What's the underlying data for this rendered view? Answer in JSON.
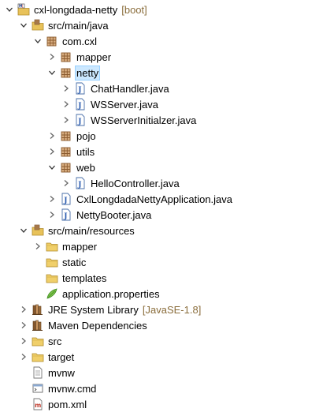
{
  "rows": [
    {
      "label": "cxl-longdada-netty",
      "decoration": "[boot]",
      "icon": "maven-project-icon",
      "expand": "expanded",
      "selected": false
    },
    {
      "label": "src/main/java",
      "decoration": "",
      "icon": "source-folder-icon",
      "expand": "expanded",
      "selected": false
    },
    {
      "label": "com.cxl",
      "decoration": "",
      "icon": "package-icon",
      "expand": "expanded",
      "selected": false
    },
    {
      "label": "mapper",
      "decoration": "",
      "icon": "package-icon",
      "expand": "collapsed",
      "selected": false
    },
    {
      "label": "netty",
      "decoration": "",
      "icon": "package-icon",
      "expand": "expanded",
      "selected": true
    },
    {
      "label": "ChatHandler.java",
      "decoration": "",
      "icon": "java-file-icon",
      "expand": "collapsed",
      "selected": false
    },
    {
      "label": "WSServer.java",
      "decoration": "",
      "icon": "java-file-icon",
      "expand": "collapsed",
      "selected": false
    },
    {
      "label": "WSServerInitialzer.java",
      "decoration": "",
      "icon": "java-file-icon",
      "expand": "collapsed",
      "selected": false
    },
    {
      "label": "pojo",
      "decoration": "",
      "icon": "package-icon",
      "expand": "collapsed",
      "selected": false
    },
    {
      "label": "utils",
      "decoration": "",
      "icon": "package-icon",
      "expand": "collapsed",
      "selected": false
    },
    {
      "label": "web",
      "decoration": "",
      "icon": "package-icon",
      "expand": "expanded",
      "selected": false
    },
    {
      "label": "HelloController.java",
      "decoration": "",
      "icon": "java-file-icon",
      "expand": "collapsed",
      "selected": false
    },
    {
      "label": "CxlLongdadaNettyApplication.java",
      "decoration": "",
      "icon": "java-file-icon",
      "expand": "collapsed",
      "selected": false
    },
    {
      "label": "NettyBooter.java",
      "decoration": "",
      "icon": "java-file-icon",
      "expand": "collapsed",
      "selected": false
    },
    {
      "label": "src/main/resources",
      "decoration": "",
      "icon": "source-folder-icon",
      "expand": "expanded",
      "selected": false
    },
    {
      "label": "mapper",
      "decoration": "",
      "icon": "folder-icon",
      "expand": "collapsed",
      "selected": false
    },
    {
      "label": "static",
      "decoration": "",
      "icon": "folder-icon",
      "expand": "none",
      "selected": false
    },
    {
      "label": "templates",
      "decoration": "",
      "icon": "folder-icon",
      "expand": "none",
      "selected": false
    },
    {
      "label": "application.properties",
      "decoration": "",
      "icon": "properties-file-icon",
      "expand": "none",
      "selected": false
    },
    {
      "label": "JRE System Library",
      "decoration": "[JavaSE-1.8]",
      "icon": "library-icon",
      "expand": "collapsed",
      "selected": false
    },
    {
      "label": "Maven Dependencies",
      "decoration": "",
      "icon": "library-icon",
      "expand": "collapsed",
      "selected": false
    },
    {
      "label": "src",
      "decoration": "",
      "icon": "folder-icon",
      "expand": "collapsed",
      "selected": false
    },
    {
      "label": "target",
      "decoration": "",
      "icon": "folder-icon",
      "expand": "collapsed",
      "selected": false
    },
    {
      "label": "mvnw",
      "decoration": "",
      "icon": "text-file-icon",
      "expand": "none",
      "selected": false
    },
    {
      "label": "mvnw.cmd",
      "decoration": "",
      "icon": "cmd-file-icon",
      "expand": "none",
      "selected": false
    },
    {
      "label": "pom.xml",
      "decoration": "",
      "icon": "maven-pom-icon",
      "expand": "none",
      "selected": false
    }
  ],
  "colors": {
    "selection_bg": "#cce8ff",
    "decoration_text": "#8a6d3b",
    "folder_yellow": "#e8c25a",
    "package_brown": "#b9895a",
    "java_blue": "#3f6cb5"
  }
}
